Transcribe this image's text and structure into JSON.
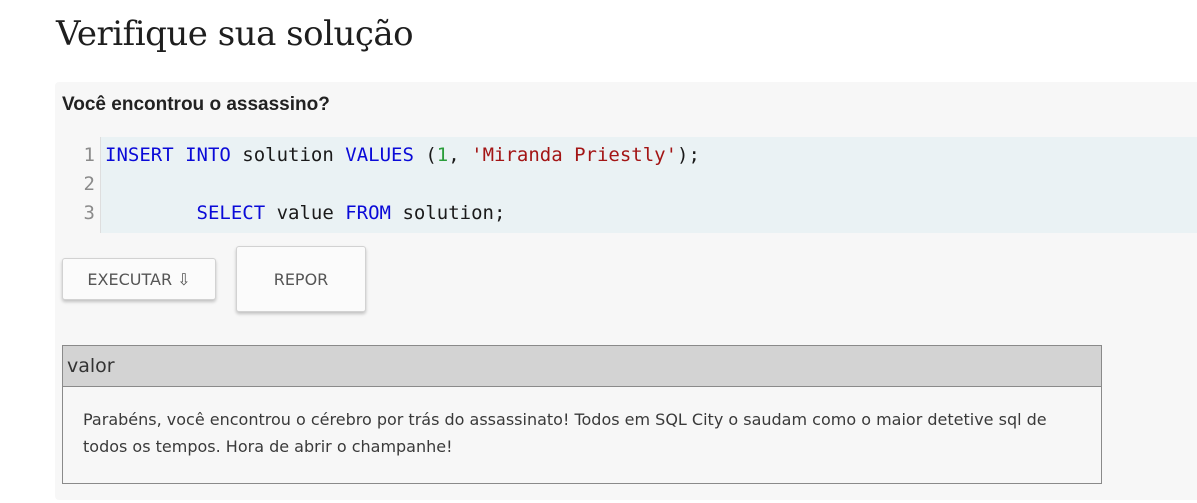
{
  "page": {
    "title": "Verifique sua solução"
  },
  "panel": {
    "heading": "Você encontrou o assassino?"
  },
  "editor": {
    "lines": [
      {
        "number": "1",
        "tokens": [
          {
            "t": "INSERT",
            "c": "kw"
          },
          {
            "t": " ",
            "c": "plain"
          },
          {
            "t": "INTO",
            "c": "kw"
          },
          {
            "t": " solution ",
            "c": "plain"
          },
          {
            "t": "VALUES",
            "c": "kw"
          },
          {
            "t": " (",
            "c": "plain"
          },
          {
            "t": "1",
            "c": "num"
          },
          {
            "t": ", ",
            "c": "plain"
          },
          {
            "t": "'Miranda Priestly'",
            "c": "str"
          },
          {
            "t": ");",
            "c": "plain"
          }
        ]
      },
      {
        "number": "2",
        "tokens": []
      },
      {
        "number": "3",
        "tokens": [
          {
            "t": "        ",
            "c": "plain"
          },
          {
            "t": "SELECT",
            "c": "kw"
          },
          {
            "t": " value ",
            "c": "plain"
          },
          {
            "t": "FROM",
            "c": "kw"
          },
          {
            "t": " solution;",
            "c": "plain"
          }
        ]
      }
    ]
  },
  "buttons": {
    "run_label": "EXECUTAR ⇩",
    "reset_label": "REPOR"
  },
  "result": {
    "column": "valor",
    "value": "Parabéns, você encontrou o cérebro por trás do assassinato! Todos em SQL City o saudam como o maior detetive sql de todos os tempos. Hora de abrir o champanhe!"
  },
  "colors": {
    "keyword": "#0a0ad8",
    "string": "#a31515",
    "number": "#2a9d3a",
    "editor_bg": "#eaf2f4",
    "header_bg": "#d3d3d3"
  }
}
